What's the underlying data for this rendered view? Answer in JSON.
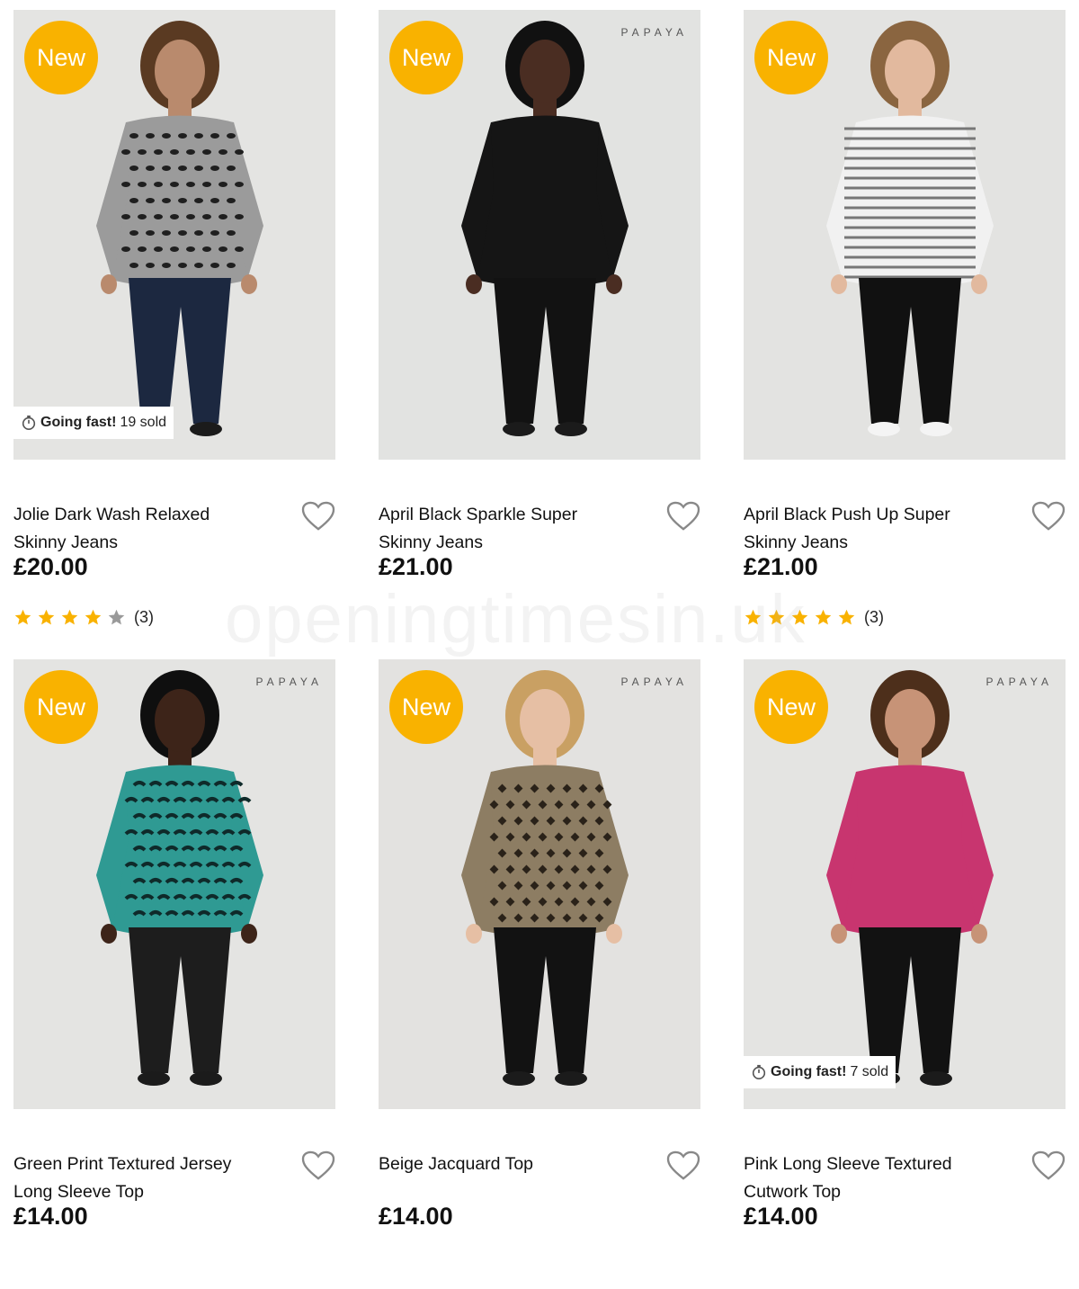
{
  "products": [
    {
      "badge": "New",
      "brand_logo": "",
      "going_fast": {
        "label": "Going fast!",
        "sold": "19 sold"
      },
      "title_line1": "Jolie Dark Wash Relaxed",
      "title_line2": "Skinny Jeans",
      "price": "£20.00",
      "rating": {
        "stars": 4,
        "max": 5,
        "count": "(3)"
      },
      "model": {
        "bg": "#e4e4e2",
        "skin": "#b98a6d",
        "hair": "#5a3a22",
        "top": "#9b9b9b",
        "top_pattern": "leopard",
        "bottom": "#1c2840",
        "shoes": "#1b1b1b"
      }
    },
    {
      "badge": "New",
      "brand_logo": "PAPAYA",
      "going_fast": null,
      "title_line1": "April Black Sparkle Super",
      "title_line2": "Skinny Jeans",
      "price": "£21.00",
      "rating": null,
      "model": {
        "bg": "#e2e3e1",
        "skin": "#4a2d22",
        "hair": "#111111",
        "top": "#151515",
        "top_pattern": "plain",
        "bottom": "#121212",
        "shoes": "#1b1b1b"
      }
    },
    {
      "badge": "New",
      "brand_logo": "",
      "going_fast": null,
      "title_line1": "April Black Push Up Super",
      "title_line2": "Skinny Jeans",
      "price": "£21.00",
      "rating": {
        "stars": 5,
        "max": 5,
        "count": "(3)"
      },
      "model": {
        "bg": "#e3e3e1",
        "skin": "#e2b99e",
        "hair": "#8a6540",
        "top": "#f1f1f1",
        "top_pattern": "stripes",
        "bottom": "#111111",
        "shoes": "#f4f4f4"
      }
    },
    {
      "badge": "New",
      "brand_logo": "PAPAYA",
      "going_fast": null,
      "title_line1": "Green Print Textured Jersey",
      "title_line2": "Long Sleeve Top",
      "price": "£14.00",
      "rating": null,
      "model": {
        "bg": "#e4e4e2",
        "skin": "#3d2419",
        "hair": "#0f0f0f",
        "top": "#2f9a93",
        "top_pattern": "zebra",
        "bottom": "#1d1d1d",
        "shoes": "#1b1b1b"
      }
    },
    {
      "badge": "New",
      "brand_logo": "PAPAYA",
      "going_fast": null,
      "title_line1": "Beige Jacquard Top",
      "title_line2": "",
      "price": "£14.00",
      "rating": null,
      "model": {
        "bg": "#e3e2e0",
        "skin": "#e6bfa4",
        "hair": "#c9a063",
        "top": "#8d7d63",
        "top_pattern": "diamond",
        "bottom": "#121212",
        "shoes": "#1b1b1b"
      }
    },
    {
      "badge": "New",
      "brand_logo": "PAPAYA",
      "going_fast": {
        "label": "Going fast!",
        "sold": "7 sold"
      },
      "title_line1": "Pink Long Sleeve Textured",
      "title_line2": "Cutwork Top",
      "price": "£14.00",
      "rating": null,
      "model": {
        "bg": "#e4e4e2",
        "skin": "#c79377",
        "hair": "#4d2f1b",
        "top": "#c8356f",
        "top_pattern": "plain",
        "bottom": "#121212",
        "shoes": "#1b1b1b"
      }
    }
  ],
  "watermark": "openingtimesin.uk",
  "colors": {
    "badge": "#f9b200",
    "star_on": "#f9b200",
    "star_off": "#9a9a9a",
    "heart_stroke": "#888888"
  },
  "icons": {
    "heart": "heart-outline-icon",
    "stopwatch": "stopwatch-icon",
    "star": "star-icon"
  }
}
